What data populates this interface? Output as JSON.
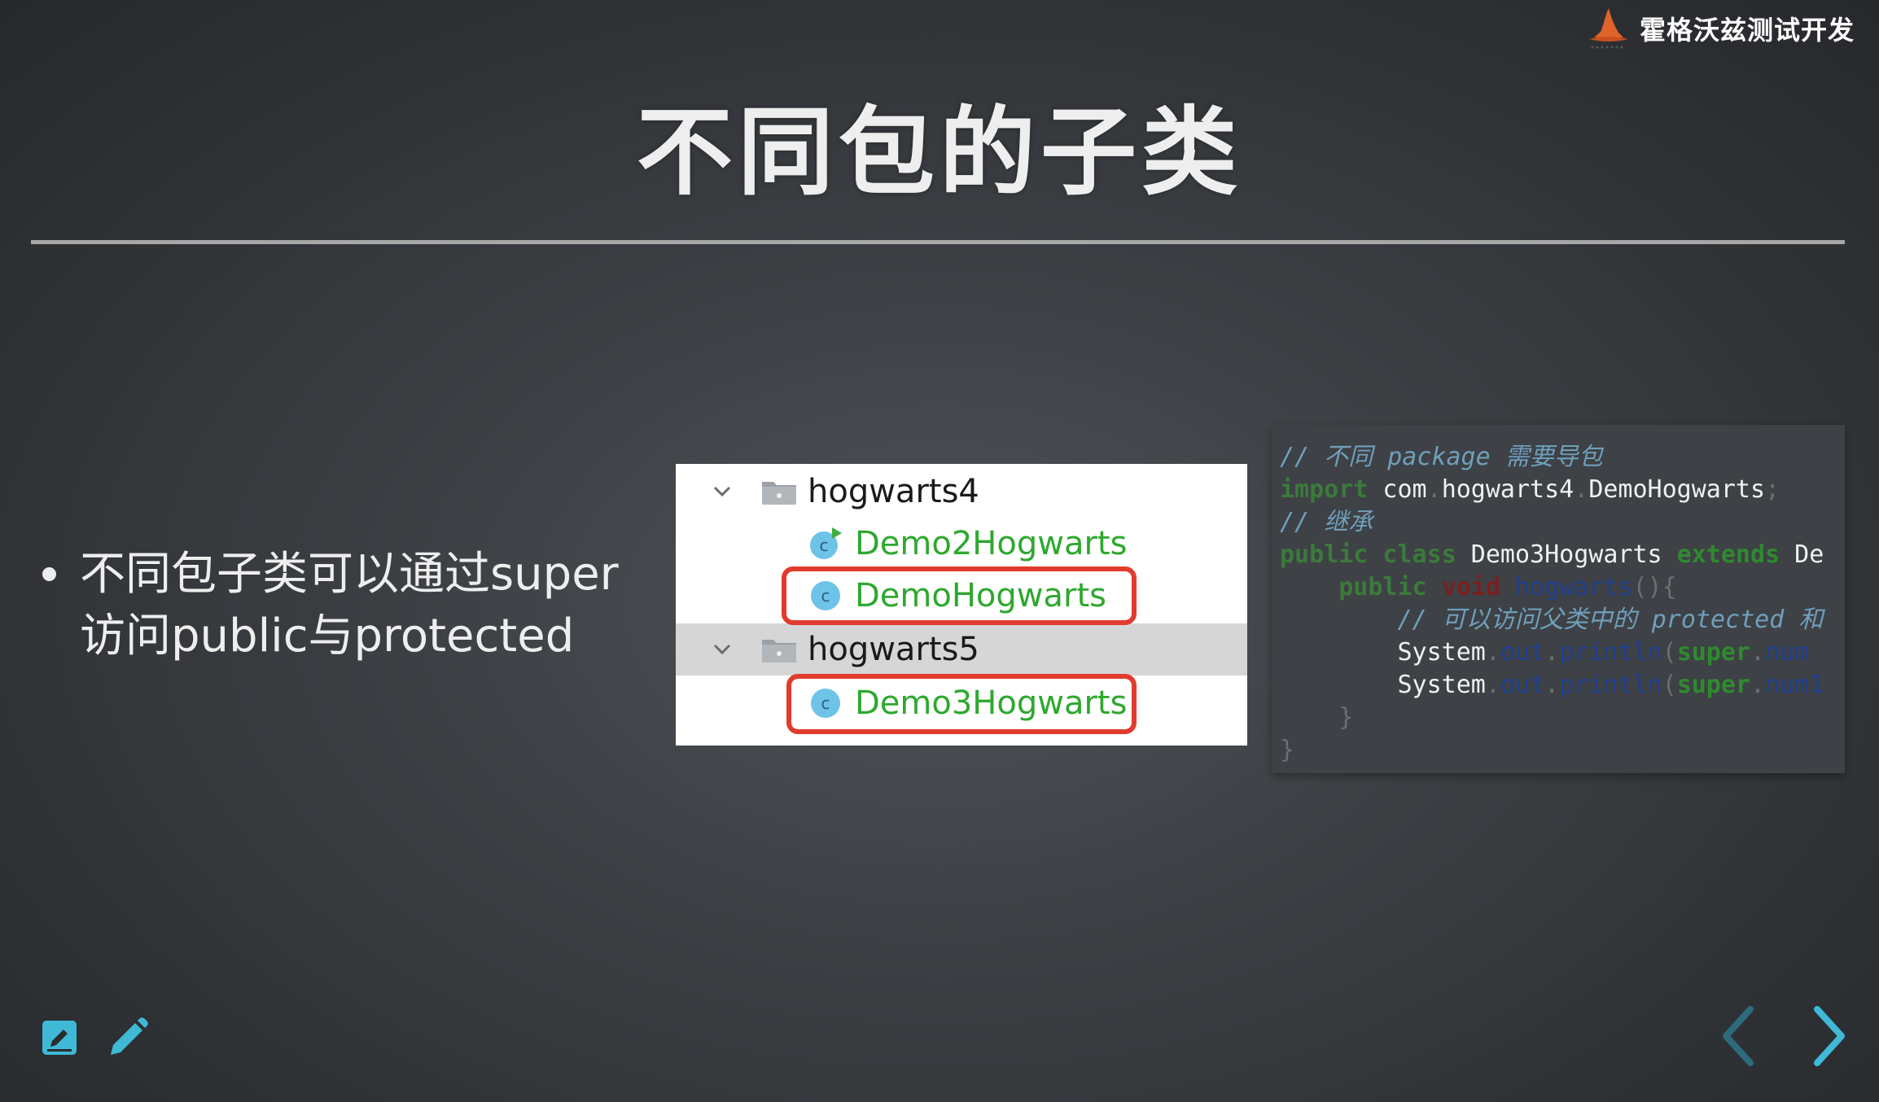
{
  "brand": {
    "name": "霍格沃兹测试开发"
  },
  "slide": {
    "title": "不同包的子类",
    "bullets": [
      {
        "line1": "不同包子类可以通过super",
        "line2": "访问public与protected"
      }
    ]
  },
  "project_tree": {
    "rows": [
      {
        "kind": "package",
        "label": "hogwarts4",
        "expanded": true,
        "selected": false
      },
      {
        "kind": "class",
        "label": "Demo2Hogwarts",
        "icon": "runnable-class-icon",
        "highlighted": false
      },
      {
        "kind": "class",
        "label": "DemoHogwarts",
        "icon": "class-icon",
        "highlighted": true
      },
      {
        "kind": "package",
        "label": "hogwarts5",
        "expanded": true,
        "selected": true
      },
      {
        "kind": "class",
        "label": "Demo3Hogwarts",
        "icon": "class-icon",
        "highlighted": true
      }
    ],
    "highlight_color": "#e23b2e",
    "class_label_color": "#2ea82e"
  },
  "code": {
    "lines": [
      {
        "tokens": [
          {
            "t": "// 不同 package 需要导包",
            "c": "comment"
          }
        ]
      },
      {
        "tokens": [
          {
            "t": "import",
            "c": "kw"
          },
          {
            "t": " com",
            "c": "plain"
          },
          {
            "t": ".",
            "c": "dim"
          },
          {
            "t": "hogwarts4",
            "c": "plain"
          },
          {
            "t": ".",
            "c": "dim"
          },
          {
            "t": "DemoHogwarts",
            "c": "plain"
          },
          {
            "t": ";",
            "c": "dim"
          }
        ]
      },
      {
        "tokens": [
          {
            "t": "// 继承",
            "c": "comment"
          }
        ]
      },
      {
        "tokens": [
          {
            "t": "public class",
            "c": "kw"
          },
          {
            "t": " Demo3Hogwarts ",
            "c": "plain"
          },
          {
            "t": "extends",
            "c": "kw2"
          },
          {
            "t": " De",
            "c": "plain"
          }
        ]
      },
      {
        "tokens": [
          {
            "t": "    public",
            "c": "kw"
          },
          {
            "t": " void",
            "c": "void"
          },
          {
            "t": " hogwarts",
            "c": "method"
          },
          {
            "t": "(){",
            "c": "dim"
          }
        ]
      },
      {
        "tokens": [
          {
            "t": "        // 可以访问父类中的 protected 和",
            "c": "comment"
          }
        ]
      },
      {
        "tokens": [
          {
            "t": "        System",
            "c": "plain"
          },
          {
            "t": ".",
            "c": "dim"
          },
          {
            "t": "out",
            "c": "field"
          },
          {
            "t": ".",
            "c": "dim"
          },
          {
            "t": "println",
            "c": "method"
          },
          {
            "t": "(",
            "c": "dim"
          },
          {
            "t": "super",
            "c": "kw2"
          },
          {
            "t": ".",
            "c": "dim"
          },
          {
            "t": "num",
            "c": "field"
          }
        ]
      },
      {
        "tokens": [
          {
            "t": "        System",
            "c": "plain"
          },
          {
            "t": ".",
            "c": "dim"
          },
          {
            "t": "out",
            "c": "field"
          },
          {
            "t": ".",
            "c": "dim"
          },
          {
            "t": "println",
            "c": "method"
          },
          {
            "t": "(",
            "c": "dim"
          },
          {
            "t": "super",
            "c": "kw2"
          },
          {
            "t": ".",
            "c": "dim"
          },
          {
            "t": "num1",
            "c": "field"
          }
        ]
      },
      {
        "tokens": [
          {
            "t": "    }",
            "c": "dim"
          }
        ]
      },
      {
        "tokens": [
          {
            "t": "}",
            "c": "dim"
          }
        ]
      }
    ]
  },
  "controls": {
    "accent_color": "#3fb9d6",
    "dim_color": "#2c6b7c",
    "prev_enabled": false,
    "next_enabled": true
  }
}
